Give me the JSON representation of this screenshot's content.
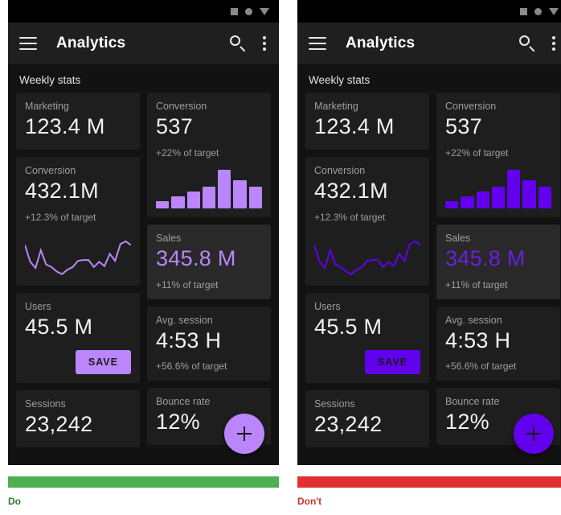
{
  "examples": [
    {
      "kind": "do",
      "caption": "Do",
      "caption_color": "#2e7d32",
      "bar_color": "#4caf50",
      "accent": "#bb86fc",
      "accent_text": "#bb86fc",
      "statusbar": {
        "icons": [
          "square-icon",
          "circle-icon",
          "triangle-down-icon"
        ]
      },
      "appbar": {
        "menu_icon": "hamburger-menu-icon",
        "title": "Analytics",
        "search_icon": "search-icon",
        "more_icon": "overflow-menu-icon"
      },
      "section_title": "Weekly stats",
      "cards": {
        "marketing": {
          "label": "Marketing",
          "value": "123.4 M"
        },
        "conversion_primary": {
          "label": "Conversion",
          "value": "537",
          "sub": "+22% of target"
        },
        "conversion_secondary": {
          "label": "Conversion",
          "value": "432.1M",
          "sub": "+12.3% of target"
        },
        "sales": {
          "label": "Sales",
          "value": "345.8 M",
          "sub": "+11% of target"
        },
        "users": {
          "label": "Users",
          "value": "45.5 M",
          "save_label": "SAVE"
        },
        "avg_session": {
          "label": "Avg. session",
          "value": "4:53 H",
          "sub": "+56.6% of target"
        },
        "sessions": {
          "label": "Sessions",
          "value": "23,242"
        },
        "bounce_rate": {
          "label": "Bounce rate",
          "value": "12%"
        }
      },
      "fab": {
        "icon": "plus-icon"
      }
    },
    {
      "kind": "dont",
      "caption": "Don't",
      "caption_color": "#d32f2f",
      "bar_color": "#e03030",
      "accent": "#6200ee",
      "accent_text": "#6a1fe0",
      "statusbar": {
        "icons": [
          "square-icon",
          "circle-icon",
          "triangle-down-icon"
        ]
      },
      "appbar": {
        "menu_icon": "hamburger-menu-icon",
        "title": "Analytics",
        "search_icon": "search-icon",
        "more_icon": "overflow-menu-icon"
      },
      "section_title": "Weekly stats",
      "cards": {
        "marketing": {
          "label": "Marketing",
          "value": "123.4 M"
        },
        "conversion_primary": {
          "label": "Conversion",
          "value": "537",
          "sub": "+22% of target"
        },
        "conversion_secondary": {
          "label": "Conversion",
          "value": "432.1M",
          "sub": "+12.3% of target"
        },
        "sales": {
          "label": "Sales",
          "value": "345.8 M",
          "sub": "+11% of target"
        },
        "users": {
          "label": "Users",
          "value": "45.5 M",
          "save_label": "SAVE"
        },
        "avg_session": {
          "label": "Avg. session",
          "value": "4:53 H",
          "sub": "+56.6% of target"
        },
        "sessions": {
          "label": "Sessions",
          "value": "23,242"
        },
        "bounce_rate": {
          "label": "Bounce rate",
          "value": "12%"
        }
      },
      "fab": {
        "icon": "plus-icon"
      }
    }
  ],
  "chart_data": [
    {
      "type": "bar",
      "title": "Conversion",
      "categories": [
        "1",
        "2",
        "3",
        "4",
        "5",
        "6",
        "7"
      ],
      "values": [
        18,
        30,
        44,
        55,
        100,
        72,
        56
      ],
      "xlabel": "",
      "ylabel": "",
      "ylim": [
        0,
        100
      ],
      "grid": false,
      "legend": "none"
    },
    {
      "type": "line",
      "title": "Conversion",
      "x": [
        0,
        1,
        2,
        3,
        4,
        5,
        6,
        7,
        8,
        9,
        10,
        11,
        12,
        13,
        14,
        15,
        16,
        17,
        18,
        19,
        20
      ],
      "values": [
        72,
        34,
        20,
        60,
        28,
        22,
        12,
        6,
        16,
        22,
        36,
        38,
        38,
        22,
        34,
        24,
        52,
        36,
        74,
        80,
        72
      ],
      "xlabel": "",
      "ylabel": "",
      "ylim": [
        0,
        100
      ],
      "grid": false,
      "legend": "none"
    }
  ]
}
